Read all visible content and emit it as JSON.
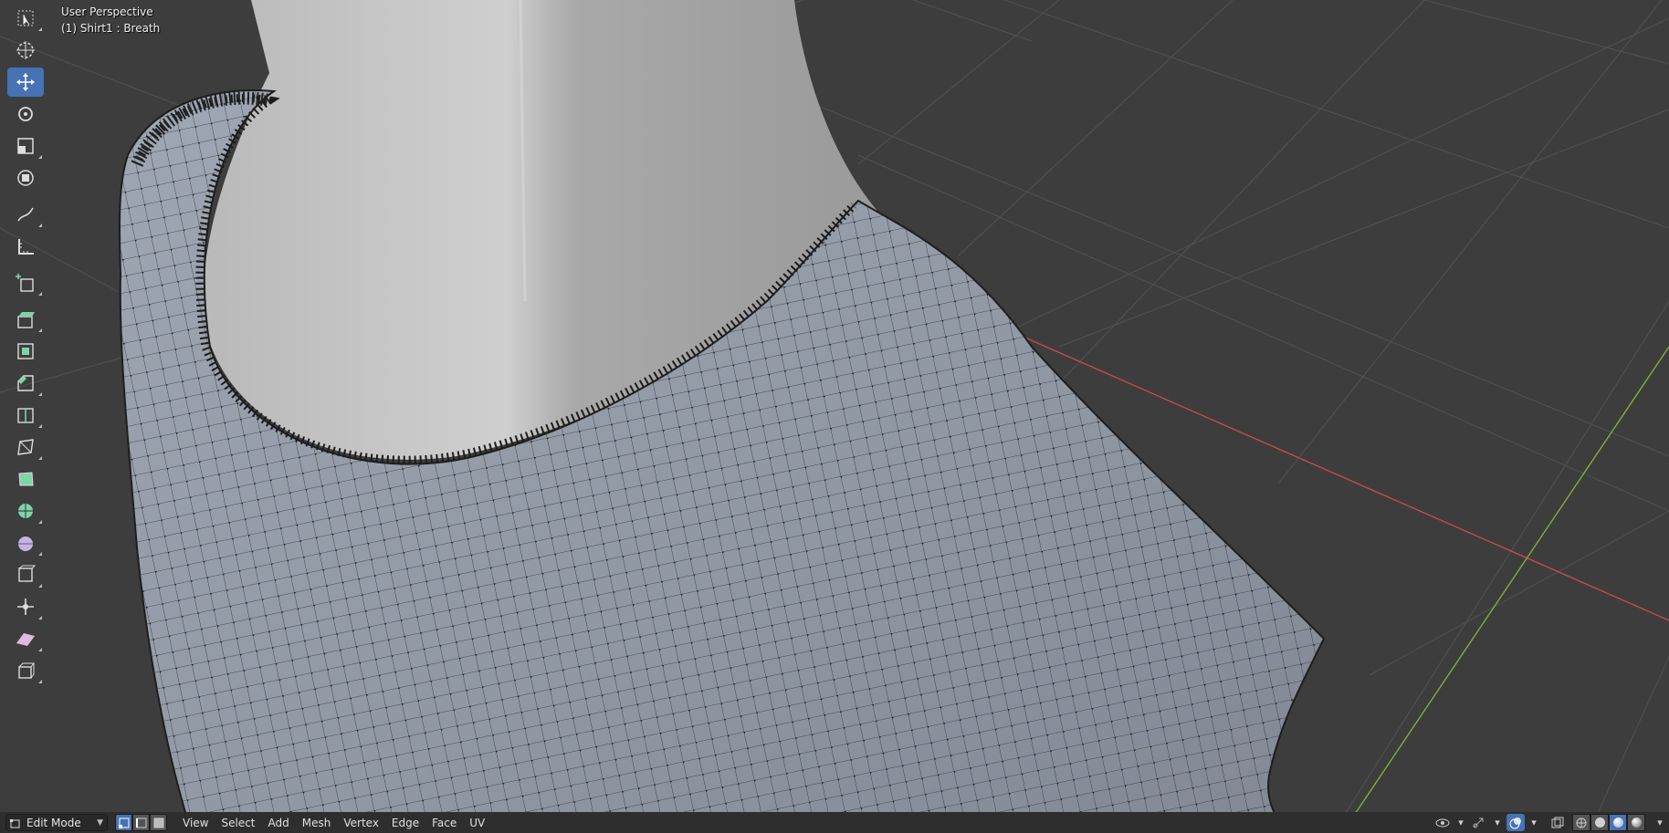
{
  "viewport": {
    "title": "User Perspective",
    "object_label": "(1) Shirt1 : Breath",
    "background_color": "#3d3d3d",
    "x_axis_color": "#c84a4a",
    "y_axis_color": "#7fae3a",
    "mesh_tint": "#8e97a4"
  },
  "toolbar": {
    "tools": [
      {
        "name": "select-box",
        "icon": "select-box-icon",
        "active": false
      },
      {
        "name": "cursor",
        "icon": "cursor-icon",
        "active": false
      },
      {
        "name": "move",
        "icon": "move-icon",
        "active": true
      },
      {
        "name": "rotate",
        "icon": "rotate-icon",
        "active": false
      },
      {
        "name": "scale",
        "icon": "scale-icon",
        "active": false
      },
      {
        "name": "transform",
        "icon": "transform-icon",
        "active": false
      },
      {
        "name": "annotate",
        "icon": "annotate-icon",
        "active": false
      },
      {
        "name": "measure",
        "icon": "measure-icon",
        "active": false
      },
      {
        "name": "add-cube",
        "icon": "add-cube-icon",
        "active": false
      },
      {
        "name": "extrude",
        "icon": "extrude-icon",
        "active": false
      },
      {
        "name": "inset",
        "icon": "inset-icon",
        "active": false
      },
      {
        "name": "bevel",
        "icon": "bevel-icon",
        "active": false
      },
      {
        "name": "loop-cut",
        "icon": "loop-cut-icon",
        "active": false
      },
      {
        "name": "knife",
        "icon": "knife-icon",
        "active": false
      },
      {
        "name": "poly-build",
        "icon": "poly-build-icon",
        "active": false
      },
      {
        "name": "spin",
        "icon": "spin-icon",
        "active": false
      },
      {
        "name": "smooth",
        "icon": "smooth-icon",
        "active": false
      },
      {
        "name": "edge-slide",
        "icon": "edge-slide-icon",
        "active": false
      },
      {
        "name": "shrink-fatten",
        "icon": "shrink-fatten-icon",
        "active": false
      },
      {
        "name": "shear",
        "icon": "shear-icon",
        "active": false
      },
      {
        "name": "rip",
        "icon": "rip-icon",
        "active": false
      }
    ]
  },
  "header": {
    "mode": "Edit Mode",
    "menus": [
      "View",
      "Select",
      "Add",
      "Mesh",
      "Vertex",
      "Edge",
      "Face",
      "UV"
    ],
    "select_modes": [
      {
        "icon": "vertex-select-icon",
        "active": true
      },
      {
        "icon": "edge-select-icon",
        "active": false
      },
      {
        "icon": "face-select-icon",
        "active": false
      }
    ],
    "right_icons": [
      "visibility-icon",
      "gizmo-icon",
      "overlay-icon",
      "xray-icon"
    ],
    "shading": [
      {
        "icon": "wireframe-shading-icon",
        "active": false
      },
      {
        "icon": "solid-shading-icon",
        "active": false
      },
      {
        "icon": "material-shading-icon",
        "active": true
      },
      {
        "icon": "rendered-shading-icon",
        "active": false
      }
    ],
    "accent_color": "#4772b3"
  }
}
